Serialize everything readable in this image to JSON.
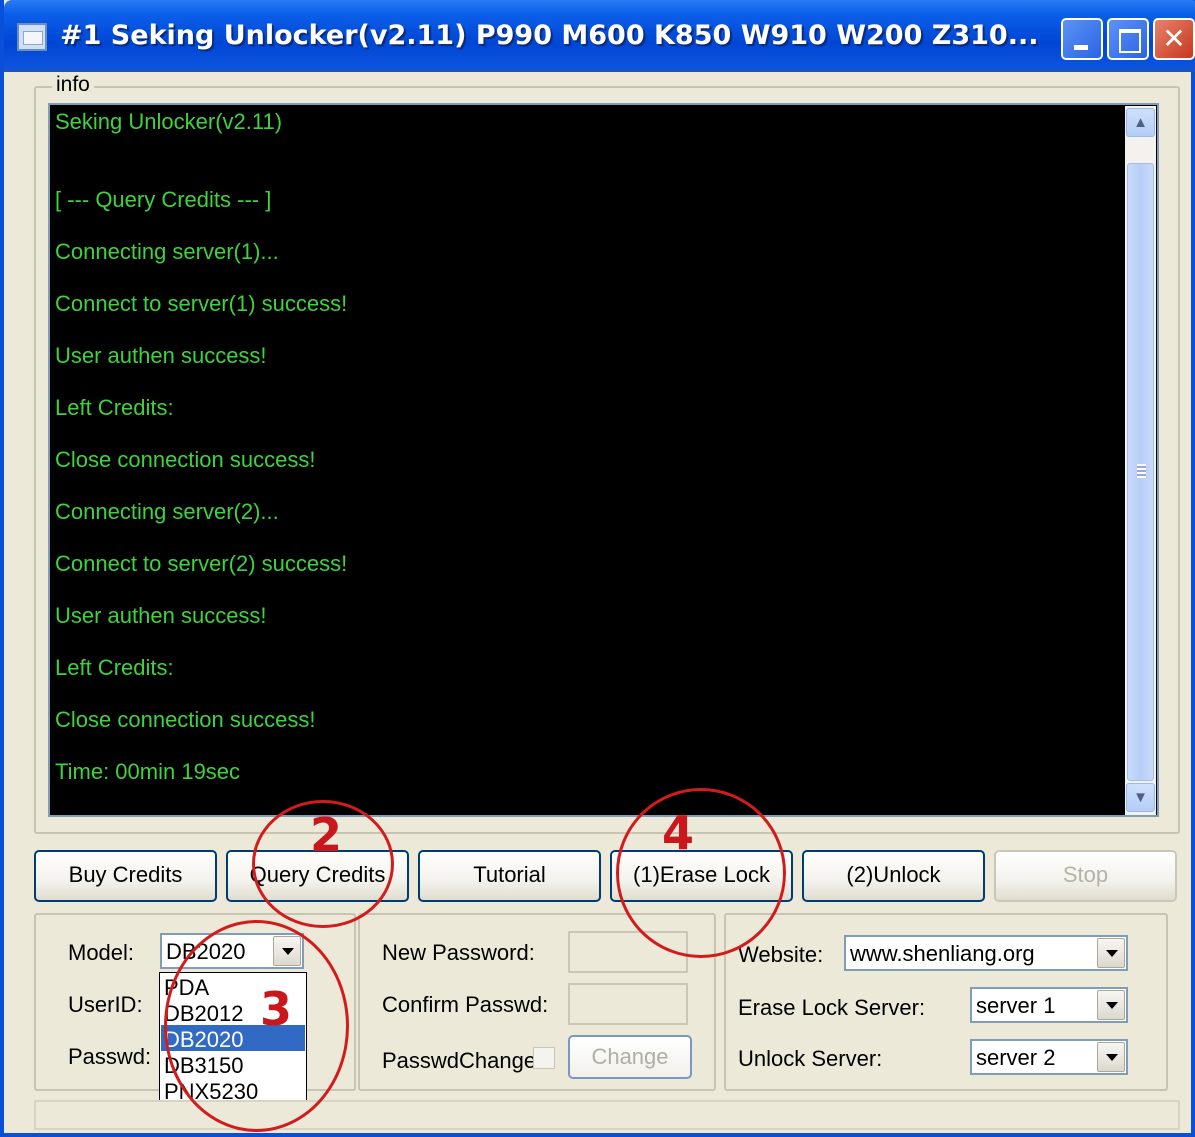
{
  "window": {
    "title": "#1 Seking Unlocker(v2.11) P990 M600 K850 W910 W200 Z310...",
    "close_glyph": "✕"
  },
  "info": {
    "group_label": "info",
    "log": [
      "Seking Unlocker(v2.11)",
      "[ --- Query Credits --- ]",
      "Connecting server(1)...",
      "Connect to server(1) success!",
      "User authen success!",
      "Left Credits:",
      "Close connection success!",
      "Connecting server(2)...",
      "Connect to server(2) success!",
      "User authen success!",
      "Left Credits:",
      "Close connection success!",
      "Time: 00min 19sec"
    ]
  },
  "buttons": {
    "buy_credits": "Buy Credits",
    "query_credits": "Query Credits",
    "tutorial": "Tutorial",
    "erase_lock": "(1)Erase Lock",
    "unlock": "(2)Unlock",
    "stop": "Stop"
  },
  "account": {
    "model_label": "Model:",
    "model_value": "DB2020",
    "userid_label": "UserID:",
    "passwd_label": "Passwd:",
    "model_options": [
      "PDA",
      "DB2012",
      "DB2020",
      "DB3150",
      "PNX5230"
    ],
    "selected_option": "DB2020"
  },
  "password": {
    "new_label": "New Password:",
    "confirm_label": "Confirm Passwd:",
    "change_check_label": "PasswdChange",
    "change_button": "Change"
  },
  "server": {
    "website_label": "Website:",
    "website_value": "www.shenliang.org",
    "erase_label": "Erase Lock Server:",
    "erase_value": "server 1",
    "unlock_label": "Unlock Server:",
    "unlock_value": "server 2"
  },
  "annotations": [
    "2",
    "3",
    "4"
  ],
  "colors": {
    "console_bg": "#000000",
    "console_text": "#3fd23f",
    "annotation_red": "#d21c1c",
    "titlebar_blue": "#0046d5",
    "selection_blue": "#316ac5"
  },
  "icons": [
    "app-icon",
    "minimize-icon",
    "maximize-icon",
    "close-icon",
    "chevron-up-icon",
    "chevron-down-icon",
    "dropdown-arrow-icon"
  ]
}
